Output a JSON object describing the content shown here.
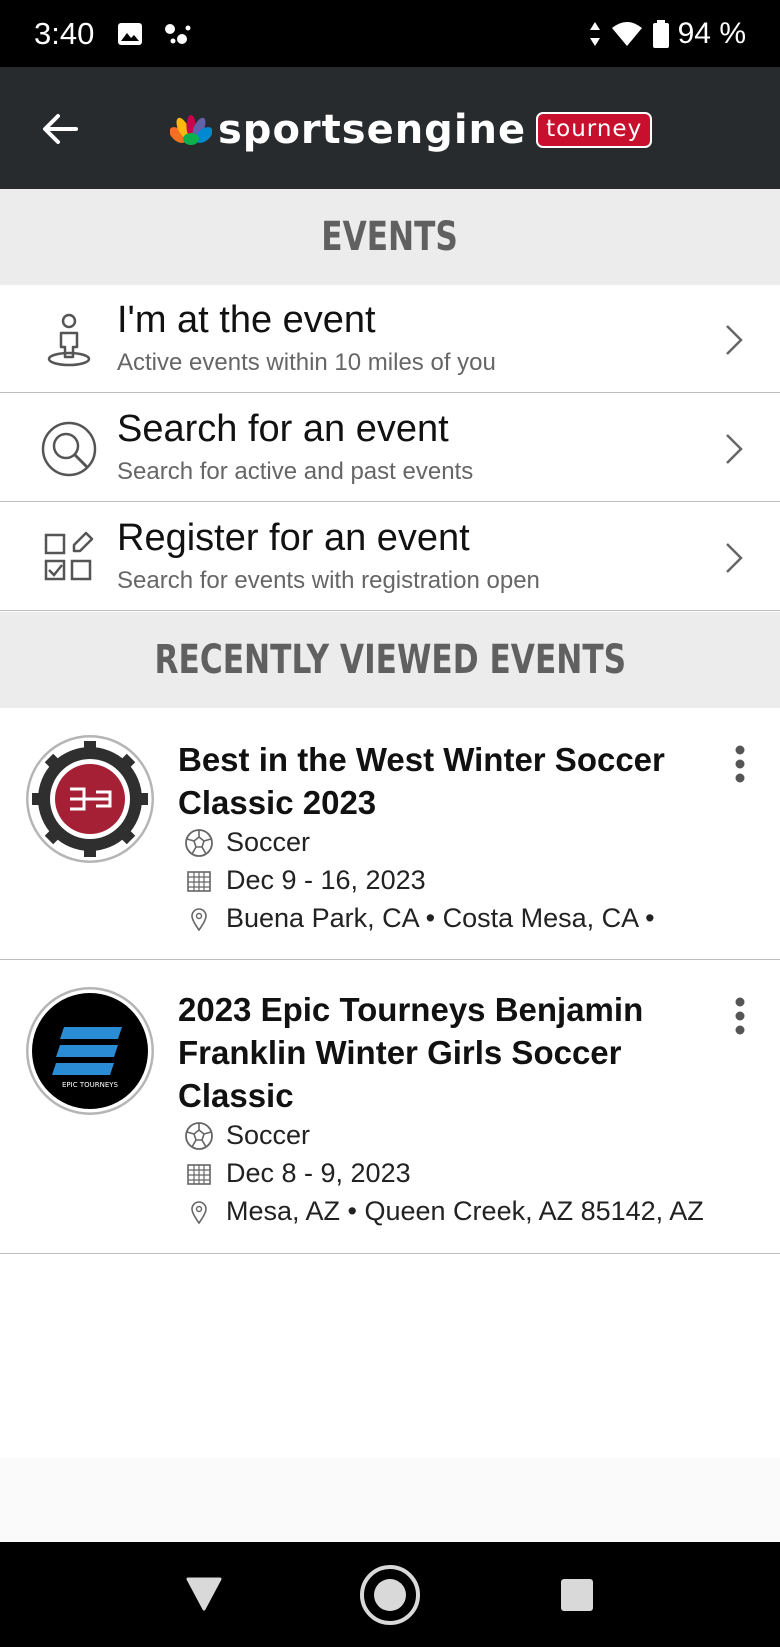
{
  "status_bar": {
    "time": "3:40",
    "battery": "94 %",
    "icons": [
      "image-icon",
      "assistant-dots-icon",
      "data-arrows-icon",
      "wifi-icon",
      "battery-icon"
    ]
  },
  "header": {
    "logo_text": "sportsengine",
    "logo_tag": "tourney",
    "brand_color": "#c8102e"
  },
  "events_section": {
    "title": "EVENTS",
    "items": [
      {
        "title": "I'm at the event",
        "subtitle": "Active events within 10 miles of you",
        "icon": "person-location-icon"
      },
      {
        "title": "Search for an event",
        "subtitle": "Search for active and past events",
        "icon": "search-icon"
      },
      {
        "title": "Register for an event",
        "subtitle": "Search for events with registration open",
        "icon": "register-checklist-icon"
      }
    ]
  },
  "recent_section": {
    "title": "RECENTLY VIEWED EVENTS",
    "events": [
      {
        "title_line1": "Best in the West Winter Soccer",
        "title_line2": "Classic 2023",
        "sport": "Soccer",
        "dates": "Dec 9 - 16, 2023",
        "locations": "Buena Park, CA • Costa Mesa, CA •"
      },
      {
        "title_line1": "2023 Epic Tourneys Benjamin",
        "title_line2": "Franklin Winter Girls Soccer",
        "title_line3": "Classic",
        "sport": "Soccer",
        "dates": "Dec 8 - 9, 2023",
        "locations": "Mesa, AZ • Queen Creek, AZ 85142, AZ",
        "badge_text": "EPIC TOURNEYS"
      }
    ]
  }
}
